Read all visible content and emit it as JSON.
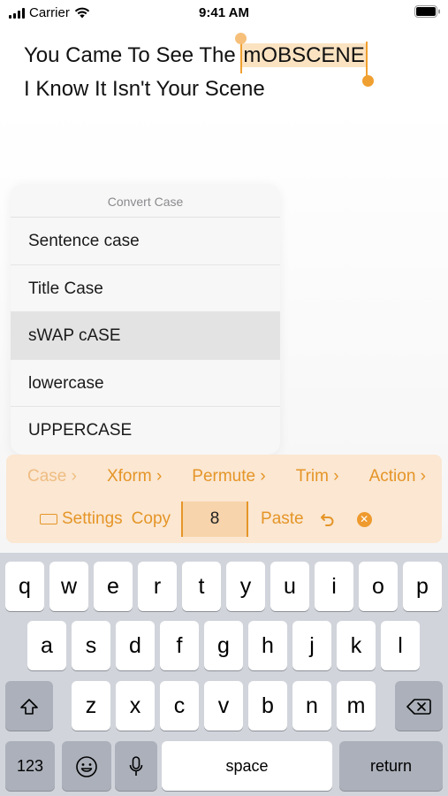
{
  "status": {
    "carrier": "Carrier",
    "time": "9:41 AM"
  },
  "editor": {
    "line1_prefix": "You Came To See The ",
    "line1_selected": "mOBSCENE",
    "line2": "I Know It Isn't Your Scene"
  },
  "menu": {
    "title": "Convert Case",
    "items": [
      "Sentence case",
      "Title Case",
      "sWAP cASE",
      "lowercase",
      "UPPERCASE"
    ]
  },
  "toolbar": {
    "case": "Case",
    "xform": "Xform",
    "permute": "Permute",
    "trim": "Trim",
    "action": "Action",
    "settings": "Settings",
    "copy": "Copy",
    "count": "8",
    "paste": "Paste"
  },
  "keyboard": {
    "row1": [
      "q",
      "w",
      "e",
      "r",
      "t",
      "y",
      "u",
      "i",
      "o",
      "p"
    ],
    "row2": [
      "a",
      "s",
      "d",
      "f",
      "g",
      "h",
      "j",
      "k",
      "l"
    ],
    "row3": [
      "z",
      "x",
      "c",
      "v",
      "b",
      "n",
      "m"
    ],
    "num": "123",
    "space": "space",
    "return": "return"
  },
  "colors": {
    "accent": "#e59527",
    "selection": "#fbe3c2",
    "toolbar_bg": "#fbe7d2"
  }
}
